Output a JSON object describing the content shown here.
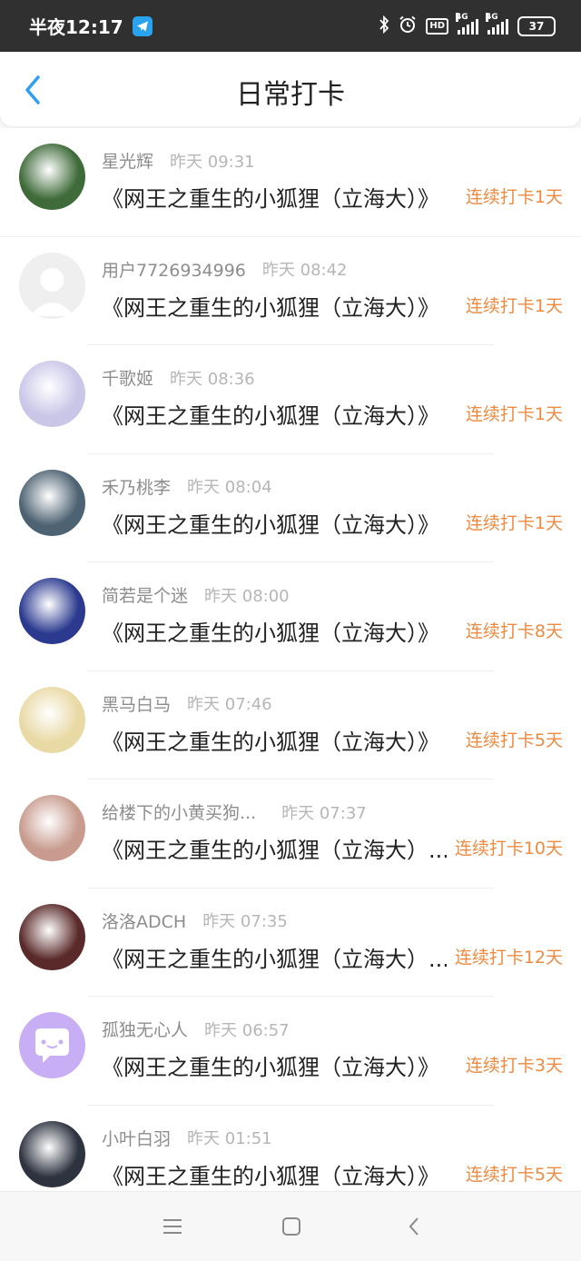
{
  "status_bar": {
    "time": "半夜12:17",
    "hd_label": "HD",
    "net1": "4G",
    "net2": "4G",
    "battery": "37"
  },
  "header": {
    "title": "日常打卡"
  },
  "checkins": [
    {
      "name": "星光辉",
      "time": "昨天 09:31",
      "book": "《网王之重生的小狐狸（立海大）》",
      "streak": "连续打卡1天",
      "avatar_color": "#3f6b3a"
    },
    {
      "name": "用户7726934996",
      "time": "昨天 08:42",
      "book": "《网王之重生的小狐狸（立海大）》",
      "streak": "连续打卡1天",
      "avatar_color": "#eeeeee"
    },
    {
      "name": "千歌姬",
      "time": "昨天 08:36",
      "book": "《网王之重生的小狐狸（立海大）》",
      "streak": "连续打卡1天",
      "avatar_color": "#c9c6e8"
    },
    {
      "name": "禾乃桃李",
      "time": "昨天 08:04",
      "book": "《网王之重生的小狐狸（立海大）》",
      "streak": "连续打卡1天",
      "avatar_color": "#4d6272"
    },
    {
      "name": "简若是个迷",
      "time": "昨天 08:00",
      "book": "《网王之重生的小狐狸（立海大）》",
      "streak": "连续打卡8天",
      "avatar_color": "#2b3a8f"
    },
    {
      "name": "黑马白马",
      "time": "昨天 07:46",
      "book": "《网王之重生的小狐狸（立海大）》",
      "streak": "连续打卡5天",
      "avatar_color": "#e9d9a4"
    },
    {
      "name": "给楼下的小黄买狗...",
      "time": "昨天 07:37",
      "book": "《网王之重生的小狐狸（立海大）...",
      "streak": "连续打卡10天",
      "avatar_color": "#c89b8e"
    },
    {
      "name": "洛洛ADCH",
      "time": "昨天 07:35",
      "book": "《网王之重生的小狐狸（立海大）...",
      "streak": "连续打卡12天",
      "avatar_color": "#5a2a2a"
    },
    {
      "name": "孤独无心人",
      "time": "昨天 06:57",
      "book": "《网王之重生的小狐狸（立海大）》",
      "streak": "连续打卡3天",
      "avatar_color": "#c7aef5"
    },
    {
      "name": "小叶白羽",
      "time": "昨天 01:51",
      "book": "《网王之重生的小狐狸（立海大）》",
      "streak": "连续打卡5天",
      "avatar_color": "#2e3340"
    }
  ],
  "colors": {
    "accent_orange": "#ef8a40",
    "back_blue": "#2f9ff3"
  }
}
